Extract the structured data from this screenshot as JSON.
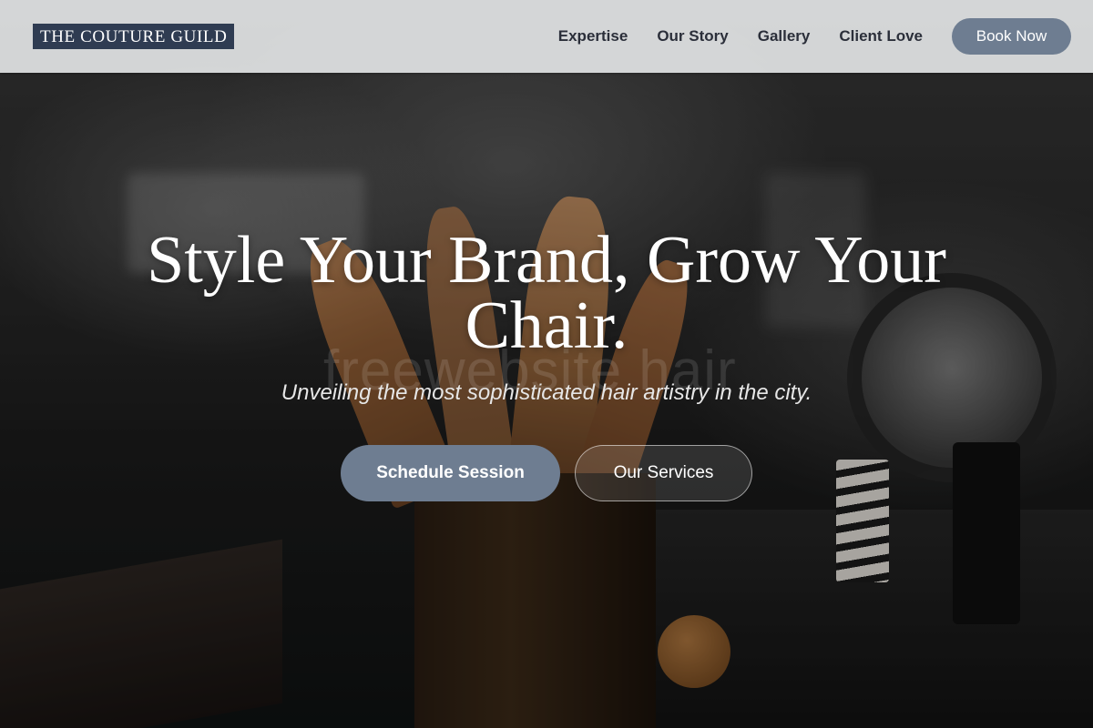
{
  "brand": {
    "logo_text": "THE COUTURE GUILD"
  },
  "nav": {
    "links": [
      "Expertise",
      "Our Story",
      "Gallery",
      "Client Love"
    ],
    "book_label": "Book Now"
  },
  "hero": {
    "headline": "Style Your Brand, Grow Your Chair.",
    "subline": "Unveiling the most sophisticated hair artistry in the city.",
    "watermark": "freewebsite hair",
    "primary_cta": "Schedule Session",
    "secondary_cta": "Our Services"
  },
  "colors": {
    "logo_bg": "#2f3c52",
    "accent": "#6e7d91",
    "header_bg": "#e1e3e4"
  }
}
